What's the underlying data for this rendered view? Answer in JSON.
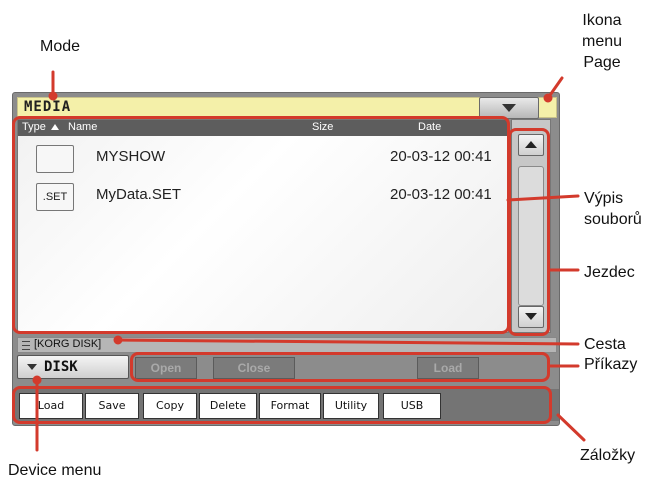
{
  "annotations": {
    "mode": "Mode",
    "menu_icon_line1": "Ikona",
    "menu_icon_line2": "menu",
    "menu_icon_line3": "Page",
    "file_list_line1": "Výpis",
    "file_list_line2": "souborů",
    "scrollbar": "Jezdec",
    "path": "Cesta",
    "commands": "Příkazy",
    "tabs": "Záložky",
    "device_menu": "Device menu"
  },
  "screen": {
    "mode_title": "MEDIA",
    "columns": {
      "type": "Type",
      "name": "Name",
      "size": "Size",
      "date": "Date"
    },
    "files": [
      {
        "icon": "",
        "name": "MYSHOW",
        "date": "20-03-12 00:41"
      },
      {
        "icon": ".SET",
        "name": "MyData.SET",
        "date": "20-03-12 00:41"
      }
    ],
    "path": "[KORG DISK]",
    "device": "DISK",
    "commands": {
      "open": "Open",
      "close": "Close",
      "load": "Load"
    },
    "tabs": [
      "Load",
      "Save",
      "Copy",
      "Delete",
      "Format",
      "Utility",
      "USB"
    ]
  },
  "colors": {
    "accent_red": "#d33a2c",
    "mode_bar": "#f4f0a9",
    "screen_gray": "#8c8c8c"
  }
}
